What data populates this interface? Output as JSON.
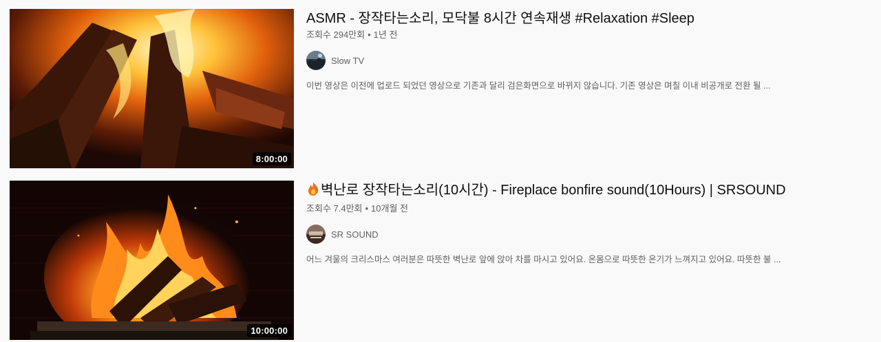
{
  "results": [
    {
      "title": "ASMR - 장작타는소리, 모닥불 8시간 연속재생 #Relaxation #Sleep",
      "views": "조회수 294만회",
      "age": "1년 전",
      "channel": "Slow TV",
      "description": "이번 영상은 이전에 업로드 되었던 영상으로 기존과 달리 검은화면으로 바뀌지 않습니다. 기존 영상은 며칠 이내 비공개로 전환 될 ...",
      "duration": "8:00:00"
    },
    {
      "title": "벽난로 장작타는소리(10시간) - Fireplace bonfire sound(10Hours) | SRSOUND",
      "title_icon": "fire-emoji-icon",
      "views": "조회수 7.4만회",
      "age": "10개월 전",
      "channel": "SR SOUND",
      "description": "어느 겨울의 크리스마스 여러분은 따뜻한 벽난로 앞에 앉아 차를 마시고 있어요. 온몸으로 따뜻한 온기가 느껴지고 있어요. 따뜻한 불 ...",
      "duration": "10:00:00"
    }
  ],
  "separator": "•",
  "colors": {
    "background": "#f9f9f9",
    "meta_text": "#606060",
    "title_text": "#0f0f0f"
  }
}
